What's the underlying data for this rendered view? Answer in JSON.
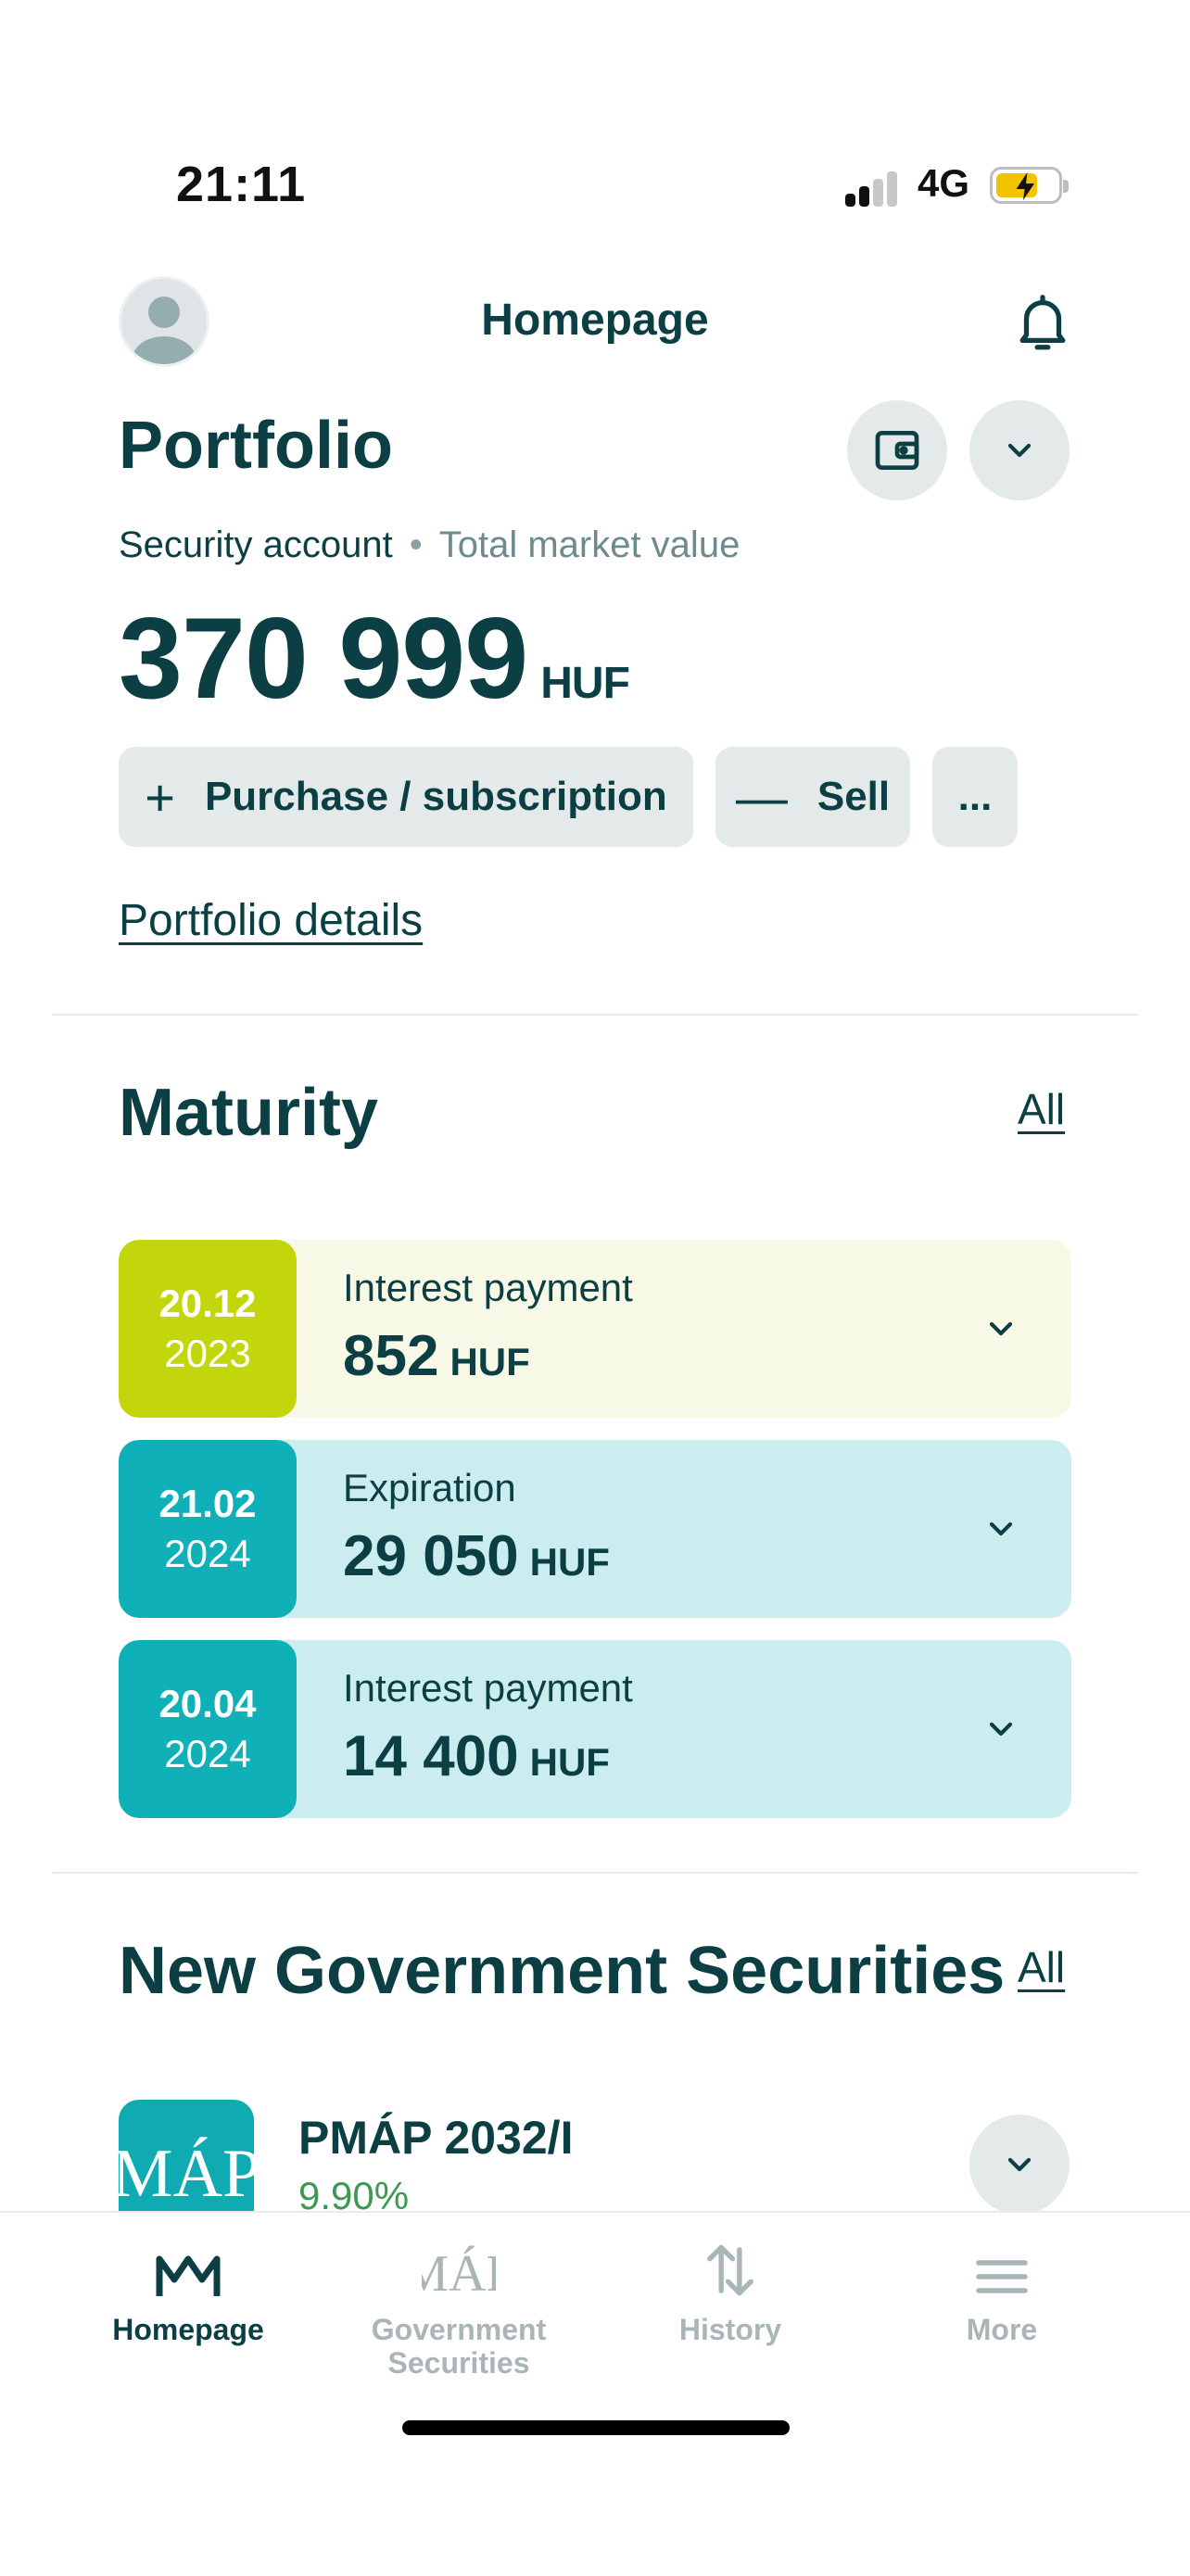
{
  "status": {
    "time": "21:11",
    "network": "4G"
  },
  "header": {
    "title": "Homepage"
  },
  "portfolio": {
    "title": "Portfolio",
    "account_label": "Security account",
    "value_label": "Total market value",
    "amount": "370 999",
    "currency": "HUF",
    "purchase_label": "Purchase / subscription",
    "sell_label": "Sell",
    "more_label": "...",
    "details_link": "Portfolio details"
  },
  "maturity": {
    "title": "Maturity",
    "all_label": "All",
    "items": [
      {
        "day_month": "20.12",
        "year": "2023",
        "type": "Interest payment",
        "amount": "852",
        "currency": "HUF",
        "date_color": "#c2d60b",
        "bg_color": "#f7f9e6"
      },
      {
        "day_month": "21.02",
        "year": "2024",
        "type": "Expiration",
        "amount": "29 050",
        "currency": "HUF",
        "date_color": "#0fb0b7",
        "bg_color": "#ccedef"
      },
      {
        "day_month": "20.04",
        "year": "2024",
        "type": "Interest payment",
        "amount": "14 400",
        "currency": "HUF",
        "date_color": "#0fb0b7",
        "bg_color": "#ccedef"
      }
    ]
  },
  "securities": {
    "title": "New Government Securities",
    "all_label": "All",
    "items": [
      {
        "name": "PMÁP 2032/I",
        "rate": "9.90%"
      }
    ]
  },
  "nav": {
    "items": [
      {
        "label": "Homepage",
        "icon": "home-logo-icon",
        "active": true
      },
      {
        "label": "Government\nSecurities",
        "icon": "government-securities-icon",
        "active": false
      },
      {
        "label": "History",
        "icon": "history-arrows-icon",
        "active": false
      },
      {
        "label": "More",
        "icon": "hamburger-menu-icon",
        "active": false
      }
    ]
  },
  "colors": {
    "primary": "#0b3f44",
    "teal": "#0fb0b7",
    "lime": "#c2d60b",
    "button_bg": "#e4e9ea"
  }
}
